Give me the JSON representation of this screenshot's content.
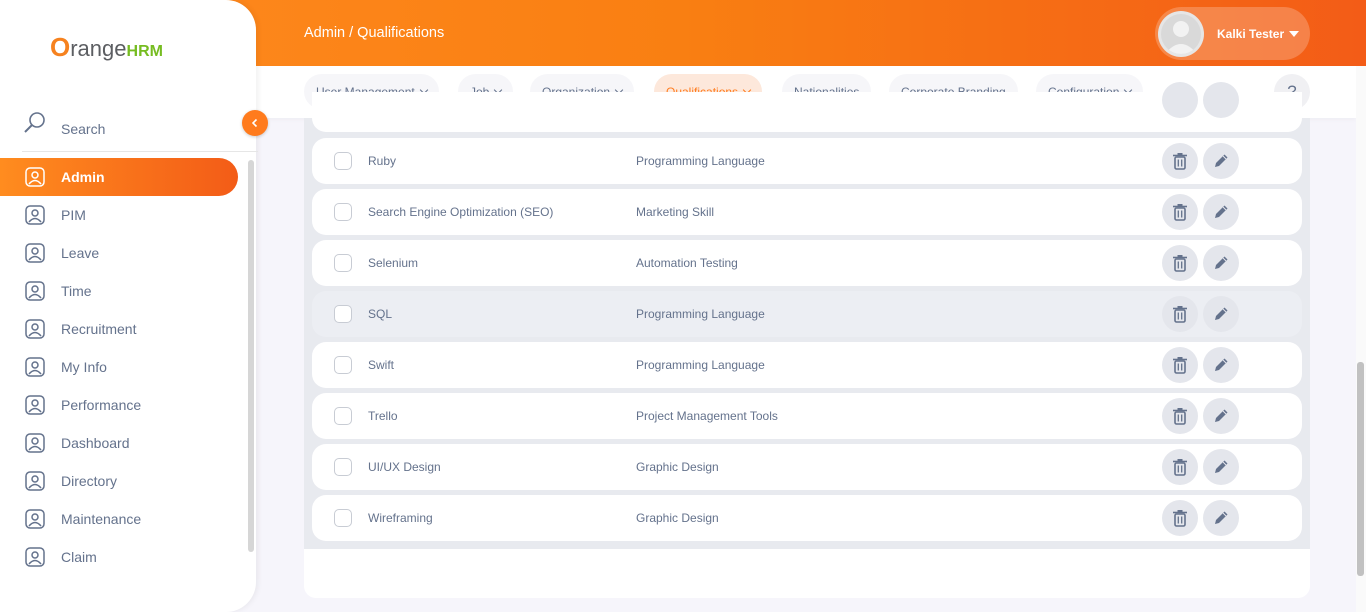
{
  "header": {
    "breadcrumb": "Admin / Qualifications",
    "user_name": "Kalki Tester"
  },
  "logo": {
    "o": "O",
    "text": "range",
    "hrm": "HRM"
  },
  "sidebar": {
    "search_label": "Search",
    "items": [
      {
        "label": "Admin",
        "icon": "admin-icon",
        "active": true
      },
      {
        "label": "PIM",
        "icon": "pim-icon"
      },
      {
        "label": "Leave",
        "icon": "leave-icon"
      },
      {
        "label": "Time",
        "icon": "time-icon"
      },
      {
        "label": "Recruitment",
        "icon": "recruitment-icon"
      },
      {
        "label": "My Info",
        "icon": "my-info-icon"
      },
      {
        "label": "Performance",
        "icon": "performance-icon"
      },
      {
        "label": "Dashboard",
        "icon": "dashboard-icon"
      },
      {
        "label": "Directory",
        "icon": "directory-icon"
      },
      {
        "label": "Maintenance",
        "icon": "maintenance-icon"
      },
      {
        "label": "Claim",
        "icon": "claim-icon"
      }
    ]
  },
  "topnav": {
    "items": [
      {
        "label": "User Management",
        "dropdown": true
      },
      {
        "label": "Job",
        "dropdown": true
      },
      {
        "label": "Organization",
        "dropdown": true
      },
      {
        "label": "Qualifications",
        "dropdown": true,
        "active": true
      },
      {
        "label": "Nationalities",
        "dropdown": false
      },
      {
        "label": "Corporate Branding",
        "dropdown": false
      },
      {
        "label": "Configuration",
        "dropdown": true
      }
    ],
    "help": "?"
  },
  "table": {
    "rows": [
      {
        "name": "Ruby",
        "category": "Programming Language"
      },
      {
        "name": "Search Engine Optimization (SEO)",
        "category": "Marketing Skill"
      },
      {
        "name": "Selenium",
        "category": "Automation Testing"
      },
      {
        "name": "SQL",
        "category": "Programming Language",
        "hover": true
      },
      {
        "name": "Swift",
        "category": "Programming Language"
      },
      {
        "name": "Trello",
        "category": "Project Management Tools"
      },
      {
        "name": "UI/UX Design",
        "category": "Graphic Design"
      },
      {
        "name": "Wireframing",
        "category": "Graphic Design"
      }
    ]
  },
  "colors": {
    "accent": "#ff7b1d",
    "brand_green": "#76bc21",
    "text": "#64728c"
  }
}
